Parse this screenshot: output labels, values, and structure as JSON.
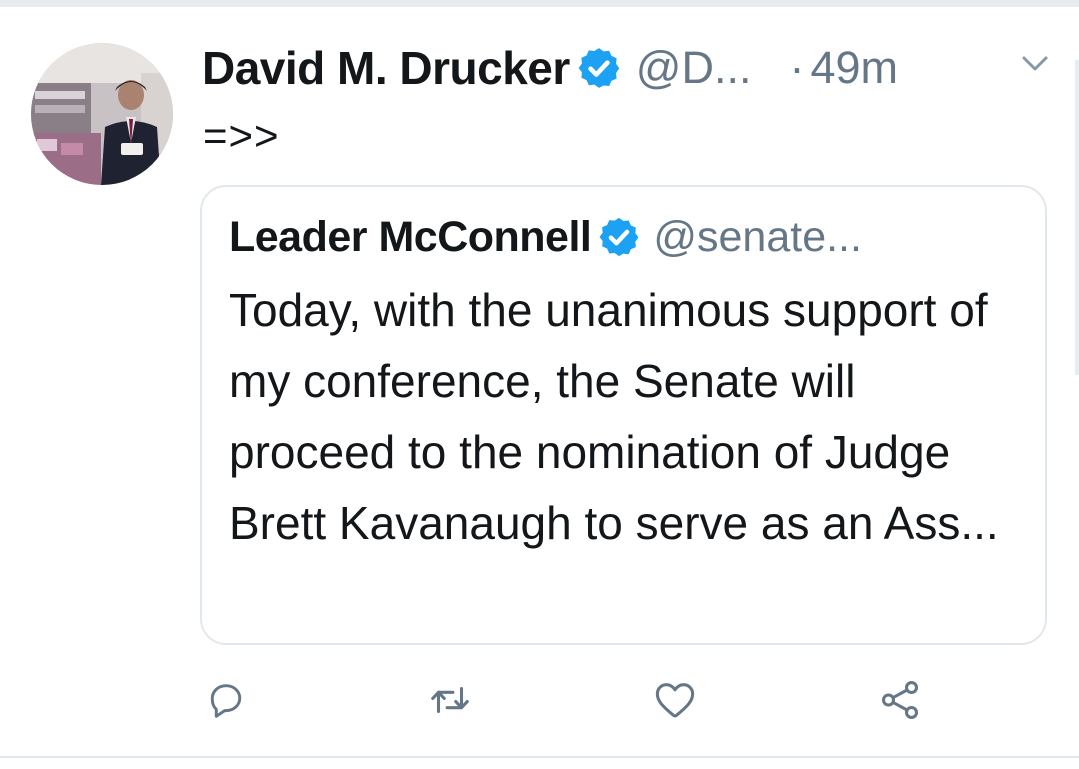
{
  "tweet": {
    "author": {
      "display_name": "David M. Drucker",
      "handle": "@D...",
      "verified": true,
      "avatar_icon": "profile-photo"
    },
    "separator": "·",
    "time": "49m",
    "text": "=>>",
    "menu_icon": "chevron-down-icon"
  },
  "quoted_tweet": {
    "author": {
      "display_name": "Leader McConnell",
      "handle": "@senate...",
      "verified": true
    },
    "text": "Today, with the unanimous support of my conference, the Senate will proceed to the nomination of Judge Brett Kavanaugh to serve as an Ass..."
  },
  "actions": [
    {
      "name": "reply",
      "icon": "reply-icon"
    },
    {
      "name": "retweet",
      "icon": "retweet-icon"
    },
    {
      "name": "like",
      "icon": "heart-icon"
    },
    {
      "name": "share",
      "icon": "share-icon"
    }
  ],
  "colors": {
    "text_primary": "#14171a",
    "text_secondary": "#657786",
    "verified_blue": "#1da1f2",
    "border": "#e1e8ed"
  }
}
